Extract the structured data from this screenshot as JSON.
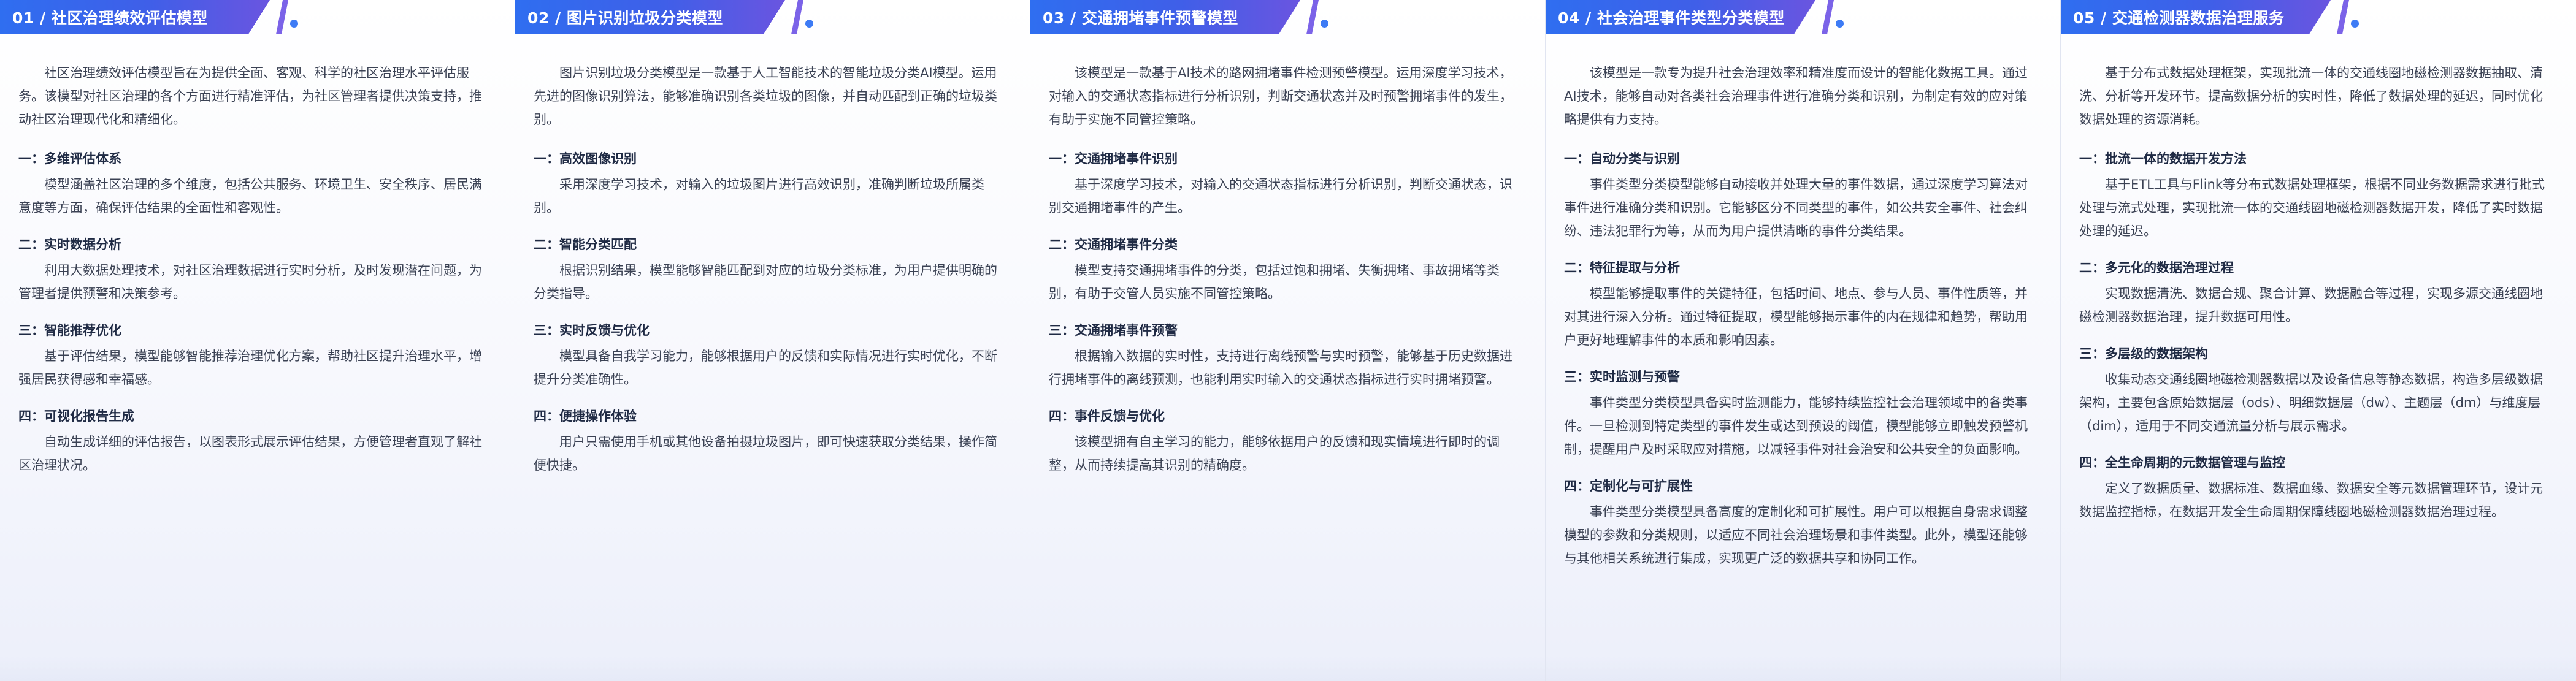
{
  "panels": [
    {
      "tab": "01 / 社区治理绩效评估模型",
      "intro": "社区治理绩效评估模型旨在为提供全面、客观、科学的社区治理水平评估服务。该模型对社区治理的各个方面进行精准评估，为社区管理者提供决策支持，推动社区治理现代化和精细化。",
      "sections": [
        {
          "title": "一：多维评估体系",
          "body": "模型涵盖社区治理的多个维度，包括公共服务、环境卫生、安全秩序、居民满意度等方面，确保评估结果的全面性和客观性。"
        },
        {
          "title": "二：实时数据分析",
          "body": "利用大数据处理技术，对社区治理数据进行实时分析，及时发现潜在问题，为管理者提供预警和决策参考。"
        },
        {
          "title": "三：智能推荐优化",
          "body": "基于评估结果，模型能够智能推荐治理优化方案，帮助社区提升治理水平，增强居民获得感和幸福感。"
        },
        {
          "title": "四：可视化报告生成",
          "body": "自动生成详细的评估报告，以图表形式展示评估结果，方便管理者直观了解社区治理状况。"
        }
      ]
    },
    {
      "tab": "02 / 图片识别垃圾分类模型",
      "intro": "图片识别垃圾分类模型是一款基于人工智能技术的智能垃圾分类AI模型。运用先进的图像识别算法，能够准确识别各类垃圾的图像，并自动匹配到正确的垃圾类别。",
      "sections": [
        {
          "title": "一：高效图像识别",
          "body": "采用深度学习技术，对输入的垃圾图片进行高效识别，准确判断垃圾所属类别。"
        },
        {
          "title": "二：智能分类匹配",
          "body": "根据识别结果，模型能够智能匹配到对应的垃圾分类标准，为用户提供明确的分类指导。"
        },
        {
          "title": "三：实时反馈与优化",
          "body": "模型具备自我学习能力，能够根据用户的反馈和实际情况进行实时优化，不断提升分类准确性。"
        },
        {
          "title": "四：便捷操作体验",
          "body": "用户只需使用手机或其他设备拍摄垃圾图片，即可快速获取分类结果，操作简便快捷。"
        }
      ]
    },
    {
      "tab": "03 / 交通拥堵事件预警模型",
      "intro": "该模型是一款基于AI技术的路网拥堵事件检测预警模型。运用深度学习技术，对输入的交通状态指标进行分析识别，判断交通状态并及时预警拥堵事件的发生，有助于实施不同管控策略。",
      "sections": [
        {
          "title": "一：交通拥堵事件识别",
          "body": "基于深度学习技术，对输入的交通状态指标进行分析识别，判断交通状态，识别交通拥堵事件的产生。"
        },
        {
          "title": "二：交通拥堵事件分类",
          "body": "模型支持交通拥堵事件的分类，包括过饱和拥堵、失衡拥堵、事故拥堵等类别，有助于交管人员实施不同管控策略。"
        },
        {
          "title": "三：交通拥堵事件预警",
          "body": "根据输入数据的实时性，支持进行离线预警与实时预警，能够基于历史数据进行拥堵事件的离线预测，也能利用实时输入的交通状态指标进行实时拥堵预警。"
        },
        {
          "title": "四：事件反馈与优化",
          "body": "该模型拥有自主学习的能力，能够依据用户的反馈和现实情境进行即时的调整，从而持续提高其识别的精确度。"
        }
      ]
    },
    {
      "tab": "04 / 社会治理事件类型分类模型",
      "intro": "该模型是一款专为提升社会治理效率和精准度而设计的智能化数据工具。通过AI技术，能够自动对各类社会治理事件进行准确分类和识别，为制定有效的应对策略提供有力支持。",
      "sections": [
        {
          "title": "一：自动分类与识别",
          "body": "事件类型分类模型能够自动接收并处理大量的事件数据，通过深度学习算法对事件进行准确分类和识别。它能够区分不同类型的事件，如公共安全事件、社会纠纷、违法犯罪行为等，从而为用户提供清晰的事件分类结果。"
        },
        {
          "title": "二：特征提取与分析",
          "body": "模型能够提取事件的关键特征，包括时间、地点、参与人员、事件性质等，并对其进行深入分析。通过特征提取，模型能够揭示事件的内在规律和趋势，帮助用户更好地理解事件的本质和影响因素。"
        },
        {
          "title": "三：实时监测与预警",
          "body": "事件类型分类模型具备实时监测能力，能够持续监控社会治理领域中的各类事件。一旦检测到特定类型的事件发生或达到预设的阈值，模型能够立即触发预警机制，提醒用户及时采取应对措施，以减轻事件对社会治安和公共安全的负面影响。"
        },
        {
          "title": "四：定制化与可扩展性",
          "body": "事件类型分类模型具备高度的定制化和可扩展性。用户可以根据自身需求调整模型的参数和分类规则，以适应不同社会治理场景和事件类型。此外，模型还能够与其他相关系统进行集成，实现更广泛的数据共享和协同工作。"
        }
      ]
    },
    {
      "tab": "05 / 交通检测器数据治理服务",
      "intro": "基于分布式数据处理框架，实现批流一体的交通线圈地磁检测器数据抽取、清洗、分析等开发环节。提高数据分析的实时性，降低了数据处理的延迟，同时优化数据处理的资源消耗。",
      "sections": [
        {
          "title": "一：批流一体的数据开发方法",
          "body": "基于ETL工具与Flink等分布式数据处理框架，根据不同业务数据需求进行批式处理与流式处理，实现批流一体的交通线圈地磁检测器数据开发，降低了实时数据处理的延迟。"
        },
        {
          "title": "二：多元化的数据治理过程",
          "body": "实现数据清洗、数据合规、聚合计算、数据融合等过程，实现多源交通线圈地磁检测器数据治理，提升数据可用性。"
        },
        {
          "title": "三：多层级的数据架构",
          "body": "收集动态交通线圈地磁检测器数据以及设备信息等静态数据，构造多层级数据架构，主要包含原始数据层（ods）、明细数据层（dw）、主题层（dm）与维度层（dim），适用于不同交通流量分析与展示需求。"
        },
        {
          "title": "四：全生命周期的元数据管理与监控",
          "body": "定义了数据质量、数据标准、数据血缘、数据安全等元数据管理环节，设计元数据监控指标，在数据开发全生命周期保障线圈地磁检测器数据治理过程。"
        }
      ]
    }
  ]
}
